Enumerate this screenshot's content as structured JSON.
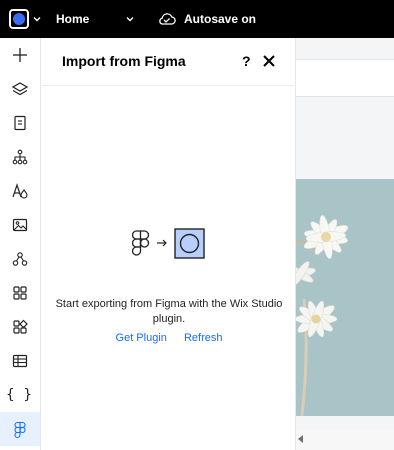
{
  "topbar": {
    "site_logo_icon": "site-logo-icon",
    "page_selector": "Home",
    "autosave_icon": "cloud-check-icon",
    "autosave_label": "Autosave on"
  },
  "left_toolbar": {
    "items": [
      {
        "id": "add",
        "icon": "plus-icon"
      },
      {
        "id": "layers",
        "icon": "layers-icon"
      },
      {
        "id": "pages",
        "icon": "page-icon"
      },
      {
        "id": "site-structure",
        "icon": "sitemap-icon"
      },
      {
        "id": "design",
        "icon": "typography-color-icon"
      },
      {
        "id": "media",
        "icon": "image-icon"
      },
      {
        "id": "components",
        "icon": "components-icon"
      },
      {
        "id": "apps",
        "icon": "apps-grid-icon"
      },
      {
        "id": "business-apps",
        "icon": "business-apps-icon"
      },
      {
        "id": "cms",
        "icon": "table-icon"
      },
      {
        "id": "code",
        "icon": "code-braces-icon",
        "glyph": "{ }"
      },
      {
        "id": "figma",
        "icon": "figma-icon",
        "active": true
      }
    ]
  },
  "panel": {
    "title": "Import from Figma",
    "help_label": "?",
    "illustration_icon": "figma-to-wix-icon",
    "message": "Start exporting from Figma with the Wix Studio plugin.",
    "links": {
      "get_plugin": "Get Plugin",
      "refresh": "Refresh"
    }
  },
  "colors": {
    "topbar": "#000000",
    "link": "#116dff",
    "active_tool_bg": "#e7f0ff",
    "canvas_image": "#a9c4c6",
    "site_logo": "#3b6cf0"
  }
}
